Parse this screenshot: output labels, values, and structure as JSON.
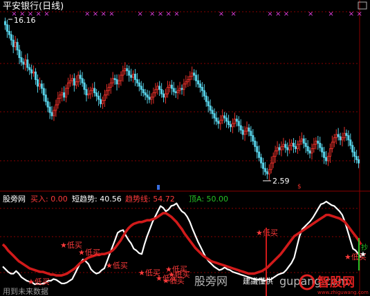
{
  "colors": {
    "background": "#000000",
    "grid": "#8a0000",
    "up_candle": "#e8302a",
    "down_candle": "#57d0e6",
    "white_line": "#ffffff",
    "red_line": "#d11a1a",
    "signal_marker": "#e040e0",
    "label_red": "#ff3b3b",
    "label_green": "#25c025",
    "watermark": "#c8c8c8",
    "logo_red": "#e02020"
  },
  "top_panel": {
    "title": "平安银行(日线)",
    "high_label": "16.16",
    "low_label": "2.59",
    "marker_glyph": "×"
  },
  "bottom_panel": {
    "indicator_name": "股旁网",
    "buy_label": "买入: 0.00",
    "short_label": "短趋势: 40.56",
    "trend_label": "趋势线: 54.72",
    "top_label": "顶A: 50.00",
    "signal_label": "★低买",
    "right_label": "抄",
    "bottom_left_text": "用到未来数据"
  },
  "watermark": {
    "site_cn": "股旁网",
    "site_en": "gupang.com",
    "logo_text": "智股网",
    "logo_url": "www.zhiguwang.com",
    "overlay_text": "建議僅供"
  },
  "chart_data": [
    {
      "type": "candlestick",
      "title": "平安银行(日线)",
      "price_max_label": 16.16,
      "price_min_label": 2.59,
      "ylim": [
        1.6,
        17.2
      ],
      "close": [
        16.2,
        15.6,
        15.3,
        14.8,
        14.2,
        14.6,
        13.9,
        13.2,
        12.8,
        12.6,
        13.0,
        12.3,
        12.1,
        11.8,
        11.9,
        11.2,
        10.6,
        10.8,
        10.4,
        9.8,
        9.2,
        8.7,
        8.2,
        7.9,
        8.4,
        8.9,
        9.5,
        9.8,
        10.0,
        9.6,
        10.4,
        10.9,
        11.1,
        11.3,
        10.7,
        11.0,
        11.6,
        11.3,
        10.9,
        10.3,
        9.8,
        9.9,
        10.2,
        10.4,
        10.0,
        9.7,
        9.4,
        9.0,
        9.3,
        9.8,
        10.2,
        10.5,
        10.9,
        11.3,
        11.2,
        10.8,
        11.1,
        11.6,
        12.0,
        12.2,
        12.0,
        11.6,
        11.4,
        11.7,
        11.2,
        10.9,
        10.6,
        10.3,
        10.0,
        9.8,
        9.6,
        9.4,
        9.6,
        10.0,
        10.3,
        10.6,
        10.3,
        9.9,
        9.6,
        9.9,
        10.5,
        10.7,
        10.4,
        10.1,
        10.0,
        10.2,
        10.4,
        10.3,
        10.8,
        11.0,
        11.2,
        11.5,
        11.8,
        11.6,
        11.1,
        10.8,
        10.5,
        10.2,
        9.7,
        9.2,
        8.8,
        8.4,
        8.1,
        7.7,
        7.4,
        7.2,
        7.5,
        7.9,
        7.7,
        7.4,
        7.1,
        6.9,
        7.2,
        7.6,
        7.4,
        7.0,
        6.6,
        6.2,
        6.5,
        6.8,
        6.5,
        6.1,
        5.6,
        5.1,
        4.6,
        4.1,
        3.6,
        3.1,
        2.8,
        2.6,
        3.0,
        3.6,
        4.2,
        4.7,
        5.0,
        4.8,
        5.1,
        5.3,
        5.0,
        4.8,
        5.2,
        5.4,
        5.1,
        4.9,
        5.3,
        5.6,
        5.8,
        5.4,
        5.1,
        4.7,
        4.5,
        4.9,
        5.3,
        5.6,
        5.4,
        5.0,
        4.6,
        4.1,
        3.8,
        4.2,
        4.9,
        5.5,
        5.9,
        6.2,
        6.0,
        5.7,
        5.9,
        6.3,
        6.1,
        5.7,
        5.2,
        4.6,
        4.2,
        3.9,
        3.6
      ],
      "signal_markers_x": [
        4,
        8,
        12,
        16,
        20,
        40,
        44,
        48,
        52,
        66,
        72,
        76,
        80,
        84,
        106,
        112,
        130,
        134,
        138,
        150,
        160,
        170,
        174
      ],
      "xlim": [
        0,
        179
      ]
    },
    {
      "type": "line",
      "ylim": [
        0,
        100
      ],
      "series": [
        {
          "name": "短趋势",
          "values": [
            30,
            27,
            24,
            22,
            22,
            25,
            22,
            18,
            16,
            14,
            13,
            12,
            10,
            11,
            10,
            11,
            12,
            14,
            14,
            16,
            15,
            13,
            11,
            11,
            12,
            14,
            16,
            22,
            28,
            34,
            38,
            36,
            33,
            27,
            24,
            22,
            23,
            26,
            28,
            36,
            44,
            52,
            60,
            68,
            70,
            71,
            65,
            60,
            56,
            50,
            48,
            45,
            44,
            55,
            64,
            72,
            80,
            86,
            92,
            98,
            96,
            92,
            94,
            98,
            99,
            101,
            96,
            92,
            90,
            86,
            80,
            72,
            65,
            58,
            52,
            46,
            40,
            36,
            33,
            30,
            28,
            26,
            27,
            29,
            27,
            26,
            24,
            23,
            22,
            21,
            20,
            19,
            18,
            17,
            16,
            15,
            16,
            15,
            14,
            16,
            15,
            17,
            19,
            21,
            22,
            23,
            26,
            30,
            34,
            40,
            52,
            64,
            72,
            75,
            78,
            81,
            85,
            90,
            95,
            100,
            101,
            103,
            101,
            99,
            98,
            95,
            92,
            88,
            80,
            70,
            60,
            50,
            48,
            44,
            40.56
          ]
        },
        {
          "name": "趋势线",
          "values": [
            55,
            52,
            48,
            45,
            42,
            39,
            36,
            34,
            32,
            30,
            28,
            27,
            26,
            25,
            24,
            24,
            23,
            22,
            21,
            21,
            20,
            20,
            20,
            21,
            22,
            24,
            26,
            28,
            31,
            34,
            36,
            38,
            40,
            41,
            42,
            43,
            43,
            44,
            44,
            45,
            46,
            48,
            51,
            55,
            59,
            64,
            69,
            73,
            76,
            78,
            79,
            80,
            80,
            81,
            82,
            82,
            83,
            84,
            86,
            88,
            90,
            90,
            88,
            86,
            83,
            80,
            76,
            72,
            67,
            63,
            59,
            55,
            51,
            48,
            45,
            42,
            40,
            38,
            36,
            35,
            34,
            33,
            32,
            31,
            30,
            29,
            28,
            27,
            26,
            25,
            24,
            23,
            22,
            22,
            22,
            23,
            24,
            25,
            27,
            29,
            32,
            35,
            38,
            41,
            44,
            48,
            52,
            56,
            60,
            64,
            66,
            68,
            70,
            72,
            74,
            76,
            78,
            80,
            82,
            84,
            86,
            88,
            88,
            87,
            86,
            85,
            84,
            82,
            80,
            76,
            72,
            68,
            64,
            60,
            54.72
          ]
        }
      ],
      "signals": [
        {
          "label": "★低买",
          "x": 45,
          "y": 14
        },
        {
          "label": "★低买",
          "x": 92,
          "y": 55
        },
        {
          "label": "★低买",
          "x": 118,
          "y": 47
        },
        {
          "label": "★低买",
          "x": 158,
          "y": 32
        },
        {
          "label": "★低买",
          "x": 205,
          "y": 24
        },
        {
          "label": "★低买",
          "x": 230,
          "y": 18
        },
        {
          "label": "★低买",
          "x": 240,
          "y": 15
        },
        {
          "label": "★低买",
          "x": 244,
          "y": 28
        },
        {
          "label": "★低买",
          "x": 248,
          "y": 22
        },
        {
          "label": "★低买",
          "x": 375,
          "y": 69
        },
        {
          "label": "★低买",
          "x": 503,
          "y": 42
        }
      ]
    }
  ]
}
